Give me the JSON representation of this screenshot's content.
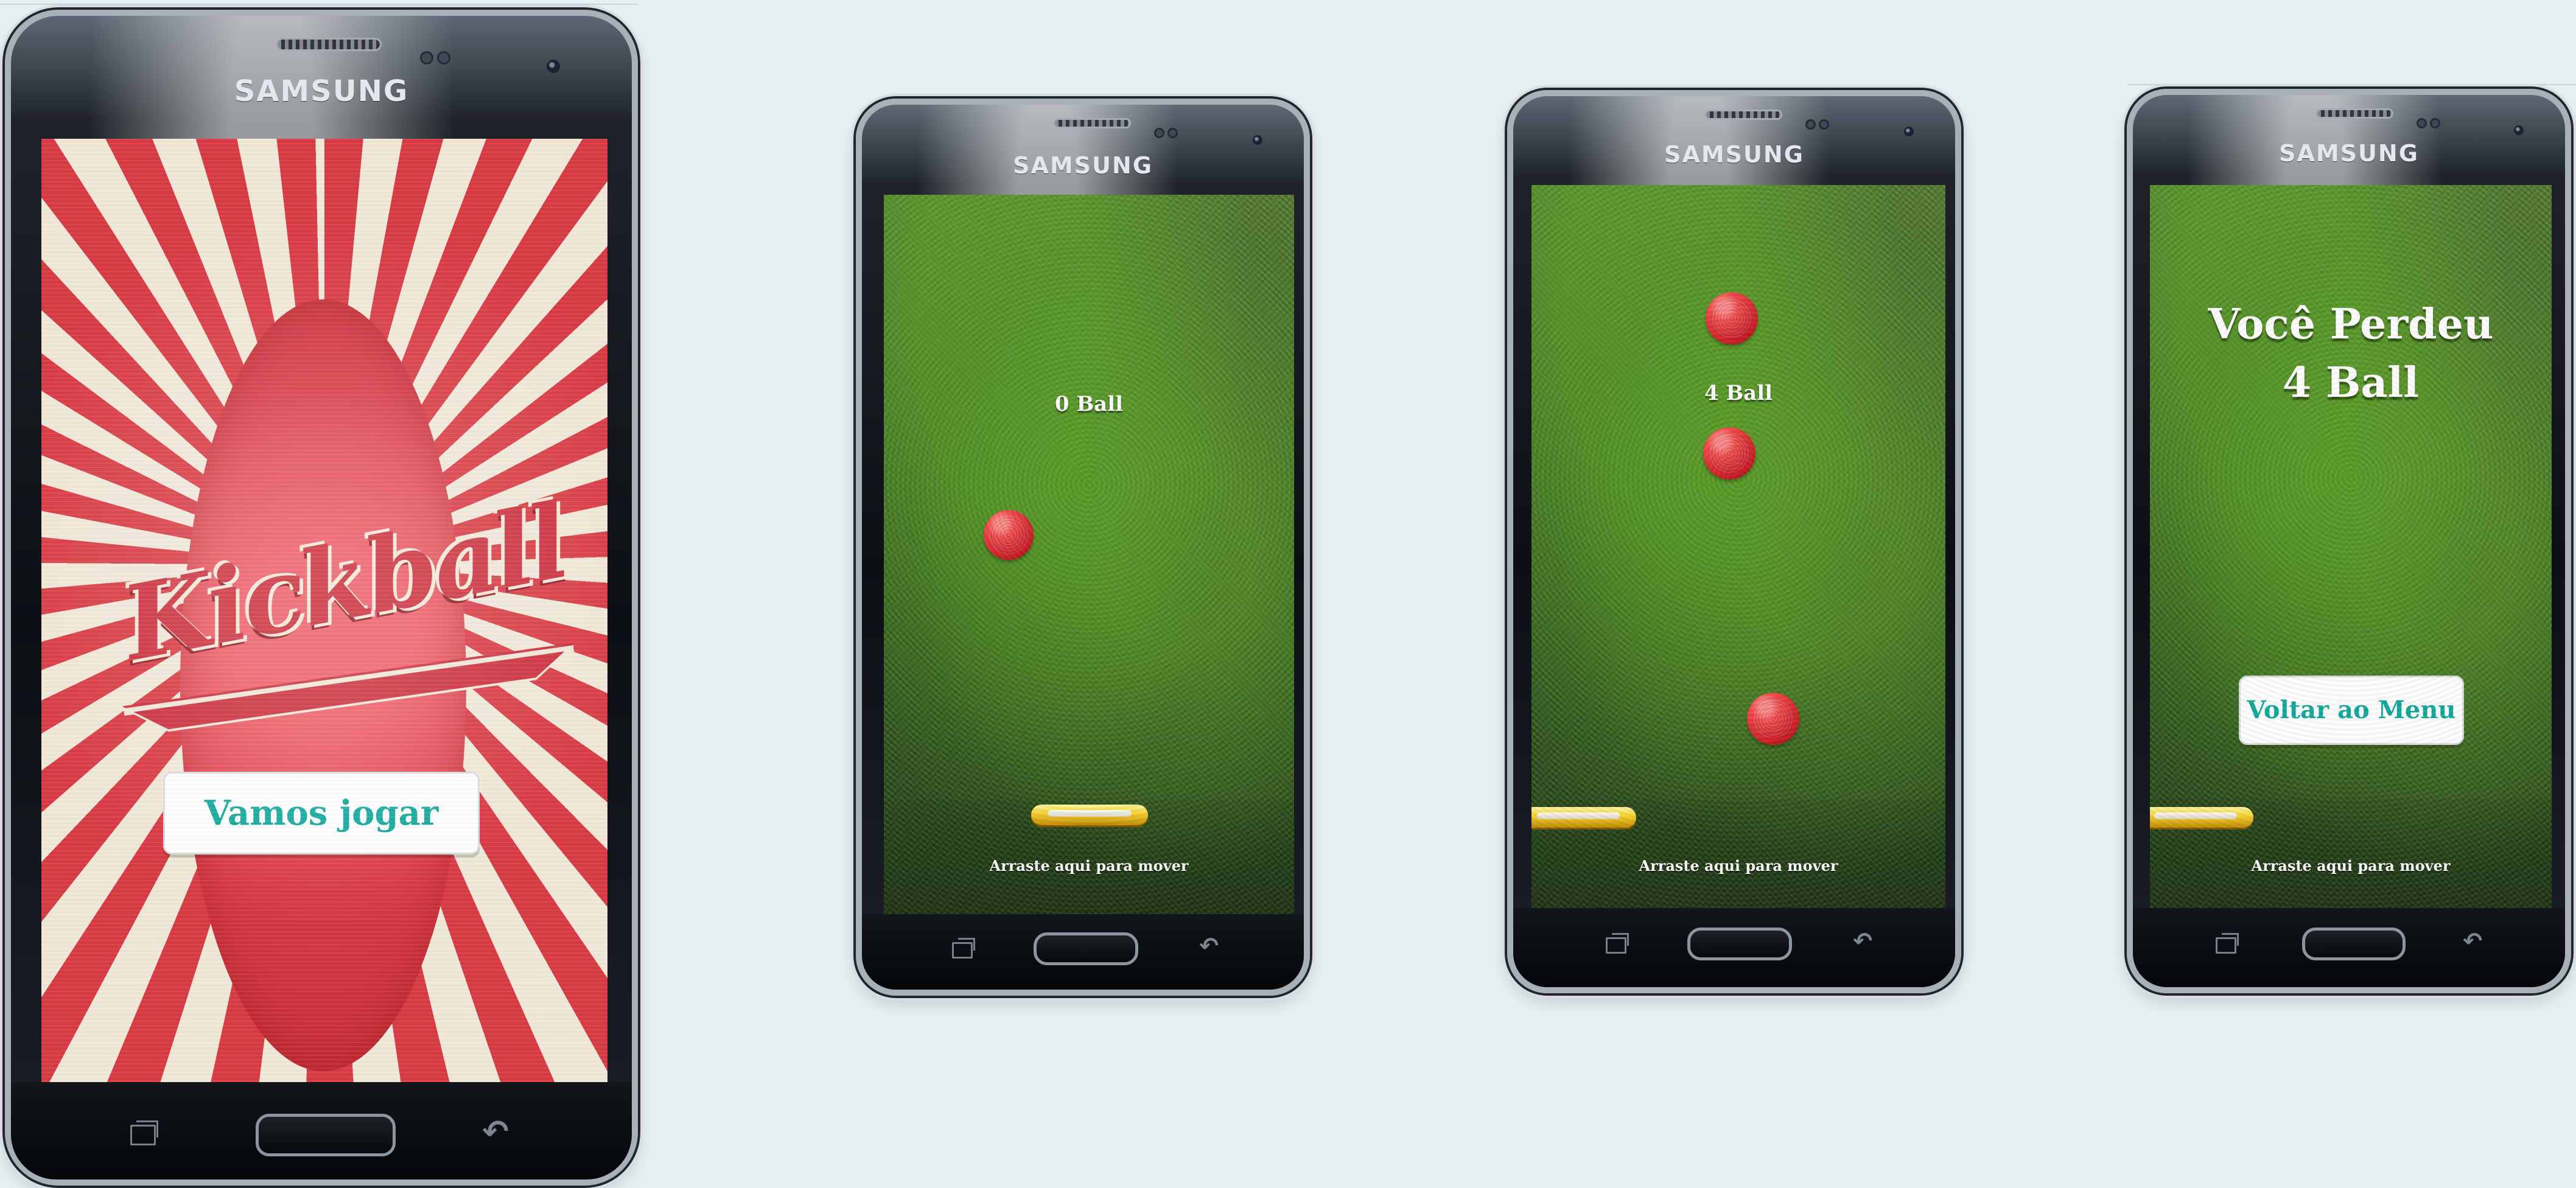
{
  "device": {
    "brand": "SAMSUNG"
  },
  "colors": {
    "background": "#e6f2f2",
    "menu_red": "#d93a43",
    "menu_cream": "#f2e8d8",
    "button_text": "#14a99c",
    "ball_red": "#e33a3d",
    "paddle_yellow": "#f7d431"
  },
  "screens": {
    "menu": {
      "logo_text": "Kickball",
      "play_button": "Vamos jogar"
    },
    "start": {
      "score": "0 Ball",
      "drag_hint": "Arraste aqui para mover"
    },
    "playing": {
      "score": "4 Ball",
      "drag_hint": "Arraste aqui para mover"
    },
    "game_over": {
      "title_line_1": "Você Perdeu",
      "title_line_2": "4 Ball",
      "menu_button": "Voltar ao Menu",
      "drag_hint": "Arraste aqui para mover"
    }
  },
  "icons": {
    "recent_apps": "recent-apps-icon",
    "home": "home-button",
    "back": "back-icon"
  }
}
